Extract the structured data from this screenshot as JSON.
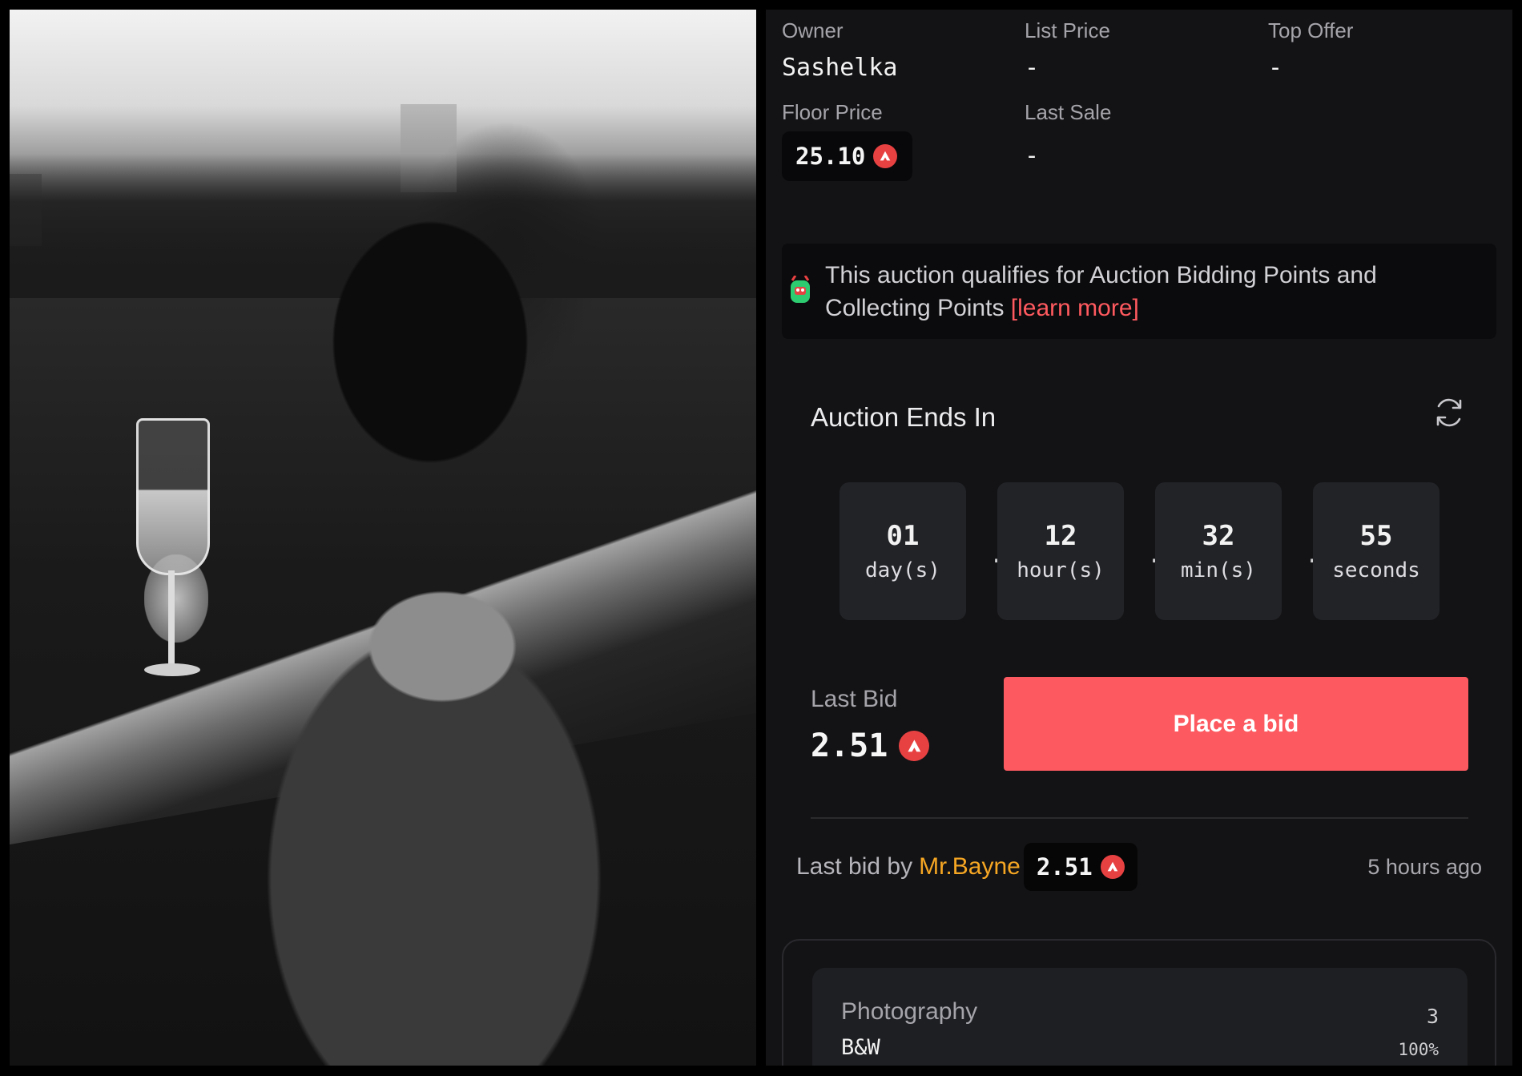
{
  "photo": {
    "alt": ""
  },
  "meta": {
    "owner_label": "Owner",
    "owner_value": "Sashelka",
    "list_price_label": "List Price",
    "list_price_value": "-",
    "top_offer_label": "Top Offer",
    "top_offer_value": "-",
    "floor_price_label": "Floor Price",
    "floor_price_value": "25.10",
    "last_sale_label": "Last Sale",
    "last_sale_value": "-"
  },
  "banner": {
    "text": "This auction qualifies for Auction Bidding Points and Collecting Points",
    "link_label": "[learn more]"
  },
  "auction": {
    "title": "Auction Ends In",
    "countdown": [
      {
        "num": "01",
        "unit": "day(s)"
      },
      {
        "num": "12",
        "unit": "hour(s)"
      },
      {
        "num": "32",
        "unit": "min(s)"
      },
      {
        "num": "55",
        "unit": "seconds"
      }
    ],
    "separator": "."
  },
  "bid": {
    "last_bid_label": "Last Bid",
    "last_bid_value": "2.51",
    "place_bid_label": "Place a bid"
  },
  "history": {
    "prefix": "Last bid by",
    "user": "Mr.Bayne",
    "amount": "2.51",
    "time": "5 hours ago"
  },
  "properties": [
    {
      "category": "Photography",
      "value": "B&W",
      "count": "3",
      "percent": "100%"
    }
  ],
  "colors": {
    "accent": "#fc5a60",
    "avax": "#e84142",
    "username": "#f5a623",
    "panel_bg": "#131315"
  },
  "icons": {
    "currency": "avax-icon",
    "refresh": "refresh-icon",
    "banner": "points-badge-icon"
  }
}
